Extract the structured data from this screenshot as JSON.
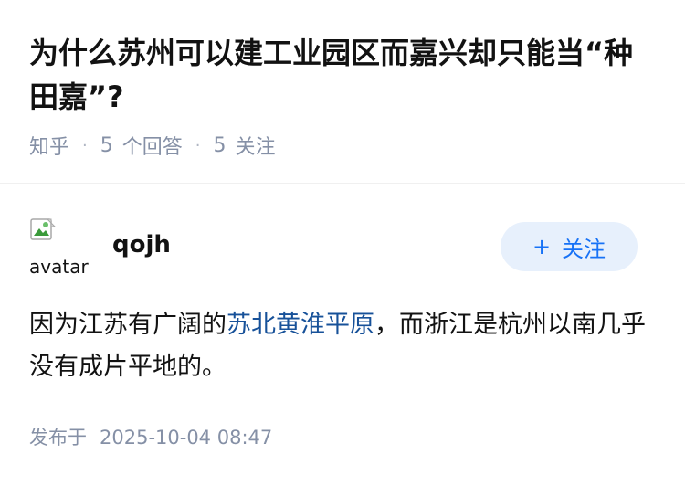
{
  "question": {
    "title": "为什么苏州可以建工业园区而嘉兴却只能当“种田嘉”?",
    "source": "知乎",
    "answer_count": "5",
    "answer_label": "个回答",
    "follower_count": "5",
    "follower_label": "关注"
  },
  "answer": {
    "author": {
      "name": "qojh",
      "avatar_alt": "avatar"
    },
    "follow_button_label": "关注",
    "content": {
      "before_link": "因为江苏有广阔的",
      "link_text": "苏北黄淮平原",
      "after_link": "，而浙江是杭州以南几乎没有成片平地的。"
    },
    "publish_label": "发布于",
    "publish_time": "2025-10-04 08:47"
  }
}
